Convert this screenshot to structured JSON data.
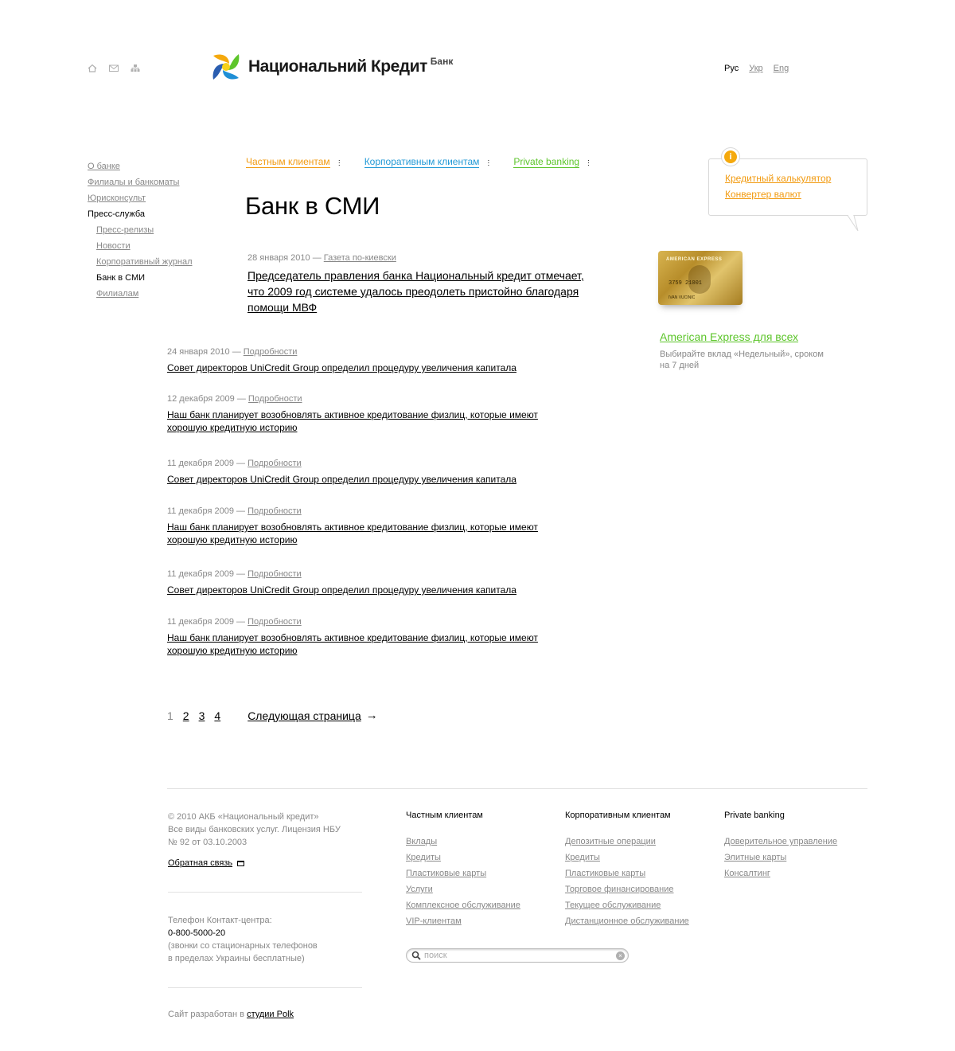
{
  "header": {
    "logo_text": "Национальний Кредит",
    "logo_sub": "Банк",
    "languages": {
      "current": "Рус",
      "ukr": "Укр",
      "eng": "Eng"
    },
    "icons": [
      "home-icon",
      "mail-icon",
      "sitemap-icon"
    ]
  },
  "leftnav": {
    "items": [
      {
        "label": "О банке"
      },
      {
        "label": "Филиалы и банкоматы"
      },
      {
        "label": "Юрисконсульт"
      },
      {
        "label": "Пресс-служба"
      },
      {
        "label": "Пресс-релизы"
      },
      {
        "label": "Новости"
      },
      {
        "label": "Корпоративный журнал"
      },
      {
        "label": "Банк в СМИ"
      },
      {
        "label": "Филиалам"
      }
    ]
  },
  "catnav": {
    "private": "Частным клиентам",
    "corporate": "Корпоративным клиентам",
    "pb": "Private banking",
    "colors": {
      "private": "#f29b11",
      "corporate": "#239ad6",
      "pb": "#5dc52b"
    }
  },
  "page": {
    "title": "Банк в СМИ"
  },
  "featured": {
    "date": "28 января 2010",
    "dash": "—",
    "source": "Газета по-киевски",
    "title": "Председатель правления банка Национальный кредит отмечает, что 2009 год системе удалось преодолеть пристойно благодаря помощи МВФ"
  },
  "news": [
    {
      "date": "24 января 2010",
      "details": "Подробности",
      "title": "Совет директоров UniCredit Group определил процедуру увеличения капитала"
    },
    {
      "date": "12 декабря 2009",
      "details": "Подробности",
      "title": "Наш банк планирует возобновлять активное кредитование физлиц, которые имеют хорошую кредитную историю"
    },
    {
      "date": "11 декабря 2009",
      "details": "Подробности",
      "title": "Совет директоров UniCredit Group определил процедуру увеличения капитала"
    },
    {
      "date": "11 декабря 2009",
      "details": "Подробности",
      "title": "Наш банк планирует возобновлять активное кредитование физлиц, которые имеют хорошую кредитную историю"
    },
    {
      "date": "11 декабря 2009",
      "details": "Подробности",
      "title": "Совет директоров UniCredit Group определил процедуру увеличения капитала"
    },
    {
      "date": "11 декабря 2009",
      "details": "Подробности",
      "title": "Наш банк планирует возобновлять активное кредитование физлиц, которые имеют хорошую кредитную историю"
    }
  ],
  "pager": {
    "pages": [
      "1",
      "2",
      "3",
      "4"
    ],
    "current": "1",
    "next": "Следующая страница",
    "arrow": "→"
  },
  "sidebar": {
    "info_glyph": "i",
    "links": [
      "Кредитный калькулятор",
      "Конвертер валют"
    ],
    "card": {
      "brand": "AMERICAN EXPRESS",
      "number": "3759  21001",
      "holder": "IVAN VUCINIC"
    },
    "promo_title": "American Express для всех",
    "promo_text": "Выбирайте вклад «Недельный», сроком на 7 дней"
  },
  "footer": {
    "copyright": "© 2010 АКБ «Национальный кредит»",
    "license_1": "Все виды банковских услуг. Лицензия НБУ",
    "license_2": "№ 92 от 03.10.2003",
    "feedback": "Обратная связь",
    "phone_label": "Телефон Контакт-центра:",
    "phone": "0-800-5000-20",
    "phone_note_1": "(звонки со стационарных телефонов",
    "phone_note_2": "в пределах Украины бесплатные)",
    "dev_prefix": "Сайт разработан в",
    "dev_link": "студии Polk",
    "col_private": {
      "heading": "Частным клиентам",
      "items": [
        "Вклады",
        "Кредиты",
        "Пластиковые карты",
        "Услуги",
        "Комплексное обслуживание",
        "VIP-клиентам"
      ]
    },
    "col_corporate": {
      "heading": "Корпоративным клиентам",
      "items": [
        "Депозитные операции",
        "Кредиты",
        "Пластиковые карты",
        "Торговое финансирование",
        "Текущее обслуживание",
        "Дистанционное обслуживание"
      ]
    },
    "col_pb": {
      "heading": "Private banking",
      "items": [
        "Доверительное управление",
        "Элитные карты",
        "Консалтинг"
      ]
    },
    "search_placeholder": "поиск",
    "search_clear": "×"
  }
}
